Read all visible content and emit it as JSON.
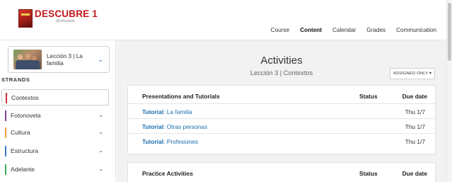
{
  "brand": {
    "title": "DESCUBRE 1",
    "publisher": "@vhlcentral"
  },
  "topnav": {
    "items": [
      "Course",
      "Content",
      "Calendar",
      "Grades",
      "Communication"
    ],
    "active": "Content"
  },
  "sidebar": {
    "lesson": {
      "title": "Lección 3 | La familia"
    },
    "strands_heading": "STRANDS",
    "strands": [
      {
        "label": "Contextos",
        "color": "#d0313b",
        "active": true,
        "expandable": false
      },
      {
        "label": "Fotonovela",
        "color": "#7b3f96",
        "active": false,
        "expandable": true
      },
      {
        "label": "Cultura",
        "color": "#e8a23a",
        "active": false,
        "expandable": true
      },
      {
        "label": "Estructura",
        "color": "#3a7dc9",
        "active": false,
        "expandable": true
      },
      {
        "label": "Adelante",
        "color": "#3fa65a",
        "active": false,
        "expandable": true
      }
    ]
  },
  "main": {
    "title": "Activities",
    "subtitle": "Lección 3 | Contextos",
    "filter_label": "ASSIGNED ONLY ▾",
    "sections": [
      {
        "title": "Presentations and Tutorials",
        "status_header": "Status",
        "due_header": "Due date",
        "rows": [
          {
            "type": "Tutorial",
            "name": ": La familia",
            "status": "",
            "due": "Thu 1/7"
          },
          {
            "type": "Tutorial",
            "name": ": Otras personas",
            "status": "",
            "due": "Thu 1/7"
          },
          {
            "type": "Tutorial",
            "name": ": Profesiones",
            "status": "",
            "due": "Thu 1/7"
          }
        ]
      },
      {
        "title": "Practice Activities",
        "status_header": "Status",
        "due_header": "Due date",
        "rows": []
      }
    ]
  },
  "colors": {
    "link": "#1d6fae",
    "brand_red": "#c4161c",
    "content_bg": "#f2f2f2"
  }
}
